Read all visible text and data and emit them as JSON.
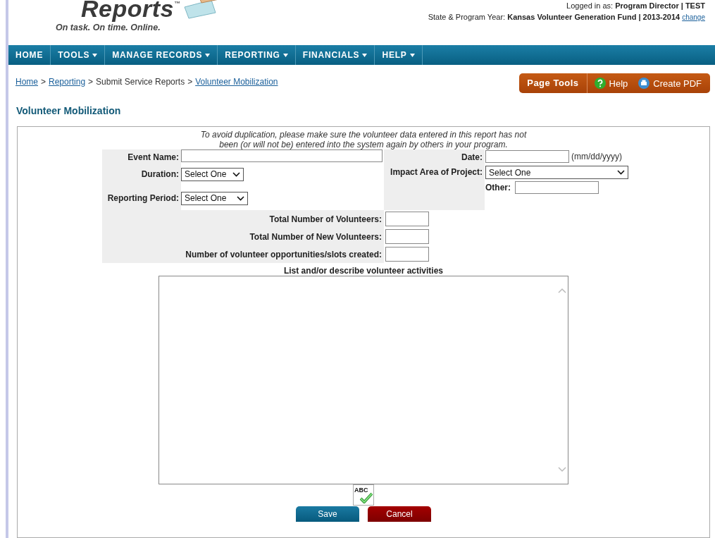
{
  "header": {
    "logo": {
      "name": "Reports",
      "mark": "™",
      "tagline": "On task. On time. Online."
    },
    "login_label": "Logged in as:",
    "login_user": "Program Director | TEST",
    "program_label": "State & Program Year:",
    "program_value": "Kansas Volunteer Generation Fund | 2013-2014",
    "change_link": "change"
  },
  "nav": [
    {
      "label": "HOME",
      "dropdown": false
    },
    {
      "label": "TOOLS",
      "dropdown": true
    },
    {
      "label": "MANAGE RECORDS",
      "dropdown": true
    },
    {
      "label": "REPORTING",
      "dropdown": true
    },
    {
      "label": "FINANCIALS",
      "dropdown": true
    },
    {
      "label": "HELP",
      "dropdown": true
    }
  ],
  "breadcrumb": [
    {
      "label": "Home",
      "link": true
    },
    {
      "separator": ">",
      "label": "Reporting",
      "link": true
    },
    {
      "separator": ">",
      "label": "Submit Service Reports",
      "link": false
    },
    {
      "separator": ">",
      "label": "Volunteer Mobilization",
      "link": true
    }
  ],
  "page_tools": {
    "title": "Page Tools",
    "help": "Help",
    "pdf": "Create PDF"
  },
  "page_title": "Volunteer Mobilization",
  "form": {
    "notice": "To avoid duplication, please make sure the volunteer data entered in this report has not been (or will not be) entered into the system again by others in your program.",
    "event_name": {
      "label": "Event Name:"
    },
    "duration": {
      "label": "Duration:",
      "value": "Select One"
    },
    "reporting_period": {
      "label": "Reporting Period:",
      "value": "Select One"
    },
    "date": {
      "label": "Date:",
      "hint": "(mm/dd/yyyy)"
    },
    "impact_area": {
      "label": "Impact Area of Project:",
      "value": "Select One"
    },
    "other": {
      "label": "Other:"
    },
    "counts": [
      {
        "label": "Total Number of Volunteers:"
      },
      {
        "label": "Total Number of New Volunteers:"
      },
      {
        "label": "Number of volunteer opportunities/slots created:"
      }
    ],
    "activities_label": "List and/or describe volunteer activities",
    "spellcheck": "ABC",
    "buttons": [
      {
        "label": "Save",
        "kind": "save"
      },
      {
        "label": "Cancel",
        "kind": "cancel"
      }
    ]
  }
}
